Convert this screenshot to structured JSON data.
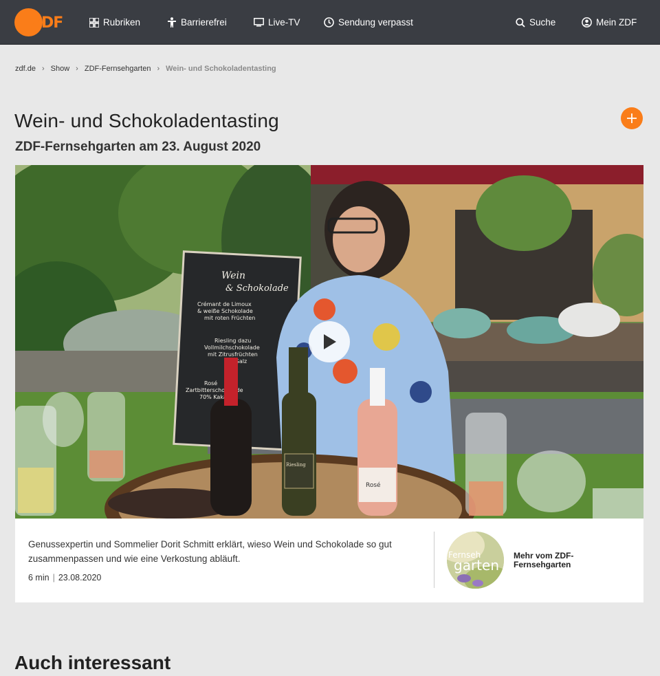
{
  "brand": {
    "logo_text": "ZDF",
    "accent": "#fa7d19",
    "header_bg": "#3a3d43"
  },
  "nav": {
    "rubriken": "Rubriken",
    "barrierefrei": "Barrierefrei",
    "livetv": "Live-TV",
    "sendung": "Sendung verpasst",
    "suche": "Suche",
    "mein": "Mein ZDF"
  },
  "breadcrumb": {
    "home": "zdf.de",
    "show": "Show",
    "program": "ZDF-Fernsehgarten",
    "current": "Wein- und Schokoladentasting"
  },
  "page": {
    "title": "Wein- und Schokoladentasting",
    "subtitle": "ZDF-Fernsehgarten am 23. August 2020"
  },
  "video": {
    "board_title_1": "Wein",
    "board_title_2": "& Schokolade",
    "board_line_1": "Crémant de Limoux",
    "board_line_2": "& weiße Schokolade",
    "board_line_3": "mit roten Früchten",
    "board_line_4": "Riesling dazu",
    "board_line_5": "Vollmilchschokolade",
    "board_line_6": "mit Zitrusfrüchten",
    "board_line_7": "& Salz",
    "board_line_8": "Rosé",
    "board_line_9": "Zartbitterschokolade",
    "board_line_10": "70% Kakao",
    "bottle_riesling": "Riesling",
    "bottle_rose": "Rosé"
  },
  "info": {
    "description": "Genussexpertin und Sommelier Dorit Schmitt erklärt, wieso Wein und Schokolade so gut zusammenpassen und wie eine Verkostung abläuft.",
    "duration": "6 min",
    "date": "23.08.2020",
    "more_label": "Mehr vom ZDF-Fernsehgarten",
    "thumb_text_1": "Fernseh",
    "thumb_text_2": "garten"
  },
  "section": {
    "title": "Auch interessant"
  },
  "icons": [
    "grid-icon",
    "accessibility-icon",
    "tv-icon",
    "clock-icon",
    "search-icon",
    "user-icon",
    "chevron-right-icon",
    "plus-icon",
    "play-icon"
  ]
}
